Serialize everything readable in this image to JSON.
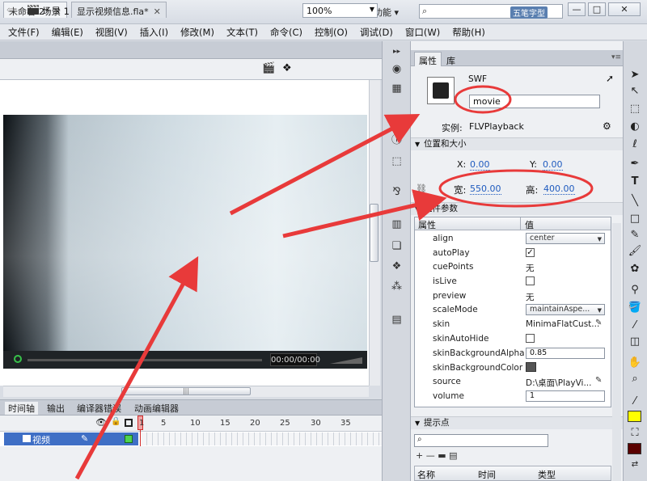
{
  "app": {
    "logo": "Fl",
    "workspace": "基本功能 ▾",
    "search_placeholder": "五笔字型"
  },
  "window_buttons": {
    "minimize": "—",
    "maximize": "□",
    "close": "✕"
  },
  "menu": [
    "文件(F)",
    "编辑(E)",
    "视图(V)",
    "插入(I)",
    "修改(M)",
    "文本(T)",
    "命令(C)",
    "控制(O)",
    "调试(D)",
    "窗口(W)",
    "帮助(H)"
  ],
  "doc_tabs": [
    {
      "label": "未命名-2*",
      "close": "✕"
    },
    {
      "label": "显示视频信息.fla*",
      "close": "✕"
    }
  ],
  "scene": {
    "label": "场景 1",
    "zoom": "100%"
  },
  "player": {
    "timecode": "00:00/00:00"
  },
  "timeline": {
    "tabs": [
      "时间轴",
      "输出",
      "编译器错误",
      "动画编辑器"
    ],
    "frame_numbers": [
      "1",
      "5",
      "10",
      "15",
      "20",
      "25",
      "30",
      "35"
    ],
    "layer_name": "视频"
  },
  "properties": {
    "tabs": {
      "properties": "属性",
      "library": "库"
    },
    "symbol_type": "SWF",
    "instance_name": "movie",
    "instance_label": "实例:",
    "instance_value": "FLVPlayback",
    "section_position": "位置和大小",
    "x_label": "X:",
    "x_value": "0.00",
    "y_label": "Y:",
    "y_value": "0.00",
    "width_label": "宽:",
    "width_value": "550.00",
    "height_label": "高:",
    "height_value": "400.00",
    "section_component": "组件参数",
    "table_header": {
      "property": "属性",
      "value": "值"
    },
    "params": [
      {
        "name": "align",
        "value": "center",
        "kind": "select"
      },
      {
        "name": "autoPlay",
        "value": "✓",
        "kind": "check"
      },
      {
        "name": "cuePoints",
        "value": "无",
        "kind": "text"
      },
      {
        "name": "isLive",
        "value": "",
        "kind": "check"
      },
      {
        "name": "preview",
        "value": "无",
        "kind": "text"
      },
      {
        "name": "scaleMode",
        "value": "maintainAspe...",
        "kind": "select"
      },
      {
        "name": "skin",
        "value": "MinimaFlatCust...",
        "kind": "text"
      },
      {
        "name": "skinAutoHide",
        "value": "",
        "kind": "check"
      },
      {
        "name": "skinBackgroundAlpha",
        "value": "0.85",
        "kind": "input"
      },
      {
        "name": "skinBackgroundColor",
        "value": "",
        "kind": "swatch"
      },
      {
        "name": "source",
        "value": "D:\\桌面\\PlayVi...",
        "kind": "text"
      },
      {
        "name": "volume",
        "value": "1",
        "kind": "input"
      }
    ],
    "section_cue": "提示点",
    "cue_tools": "+ — ▬ ▤",
    "cue_columns": {
      "name": "名称",
      "time": "时间",
      "type": "类型"
    }
  },
  "colors": {
    "accent": "#3f6fc5",
    "link": "#1f5bbf",
    "stroke": "#ffff00",
    "fill": "#5a0000",
    "annotation": "#e83a3a",
    "playhead": "#d02a2a"
  }
}
